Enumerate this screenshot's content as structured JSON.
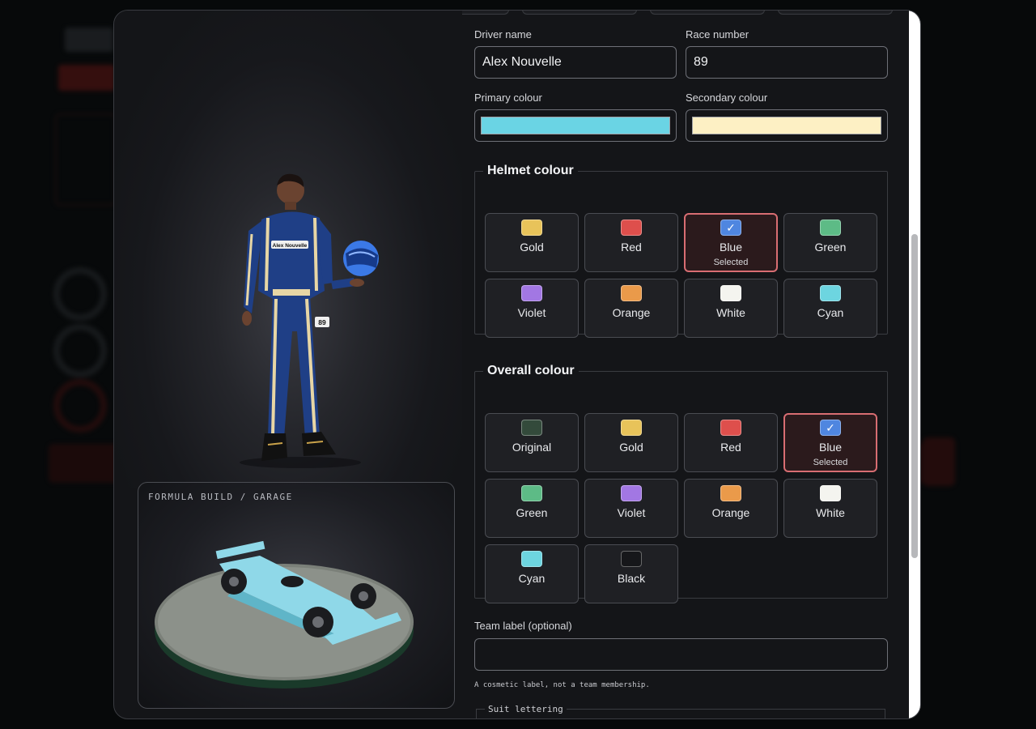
{
  "driver_badge": {
    "name": "Alex Nouvelle",
    "number": "89"
  },
  "garage": {
    "label": "FORMULA BUILD / GARAGE"
  },
  "form": {
    "driver_name": {
      "label": "Driver name",
      "value": "Alex Nouvelle"
    },
    "race_number": {
      "label": "Race number",
      "value": "89"
    },
    "primary_colour": {
      "label": "Primary colour",
      "value": "#6ad4e4"
    },
    "secondary_colour": {
      "label": "Secondary colour",
      "value": "#fdf0c4"
    },
    "helmet": {
      "legend": "Helmet colour",
      "selected_text": "Selected",
      "options": [
        {
          "name": "Gold",
          "color": "#e8c35a",
          "selected": false
        },
        {
          "name": "Red",
          "color": "#de4f4c",
          "selected": false
        },
        {
          "name": "Blue",
          "color": "#4f86e0",
          "selected": true
        },
        {
          "name": "Green",
          "color": "#5dbb86",
          "selected": false
        },
        {
          "name": "Violet",
          "color": "#a277e3",
          "selected": false
        },
        {
          "name": "Orange",
          "color": "#ea9a4a",
          "selected": false
        },
        {
          "name": "White",
          "color": "#f4f4ef",
          "selected": false
        },
        {
          "name": "Cyan",
          "color": "#6dd5e0",
          "selected": false
        }
      ]
    },
    "overall": {
      "legend": "Overall colour",
      "selected_text": "Selected",
      "options": [
        {
          "name": "Original",
          "color": "#334a3b",
          "selected": false
        },
        {
          "name": "Gold",
          "color": "#e8c35a",
          "selected": false
        },
        {
          "name": "Red",
          "color": "#de4f4c",
          "selected": false
        },
        {
          "name": "Blue",
          "color": "#4f86e0",
          "selected": true
        },
        {
          "name": "Green",
          "color": "#5dbb86",
          "selected": false
        },
        {
          "name": "Violet",
          "color": "#a277e3",
          "selected": false
        },
        {
          "name": "Orange",
          "color": "#ea9a4a",
          "selected": false
        },
        {
          "name": "White",
          "color": "#f4f4ef",
          "selected": false
        },
        {
          "name": "Cyan",
          "color": "#6dd5e0",
          "selected": false
        },
        {
          "name": "Black",
          "color": "#16171a",
          "selected": false
        }
      ]
    },
    "team_label": {
      "label": "Team label (optional)",
      "value": "",
      "hint": "A cosmetic label, not a team membership."
    },
    "suit_lettering": {
      "legend": "Suit lettering"
    }
  },
  "colors": {
    "accent_selected": "#d86d72",
    "panel_bg": "#141518"
  }
}
